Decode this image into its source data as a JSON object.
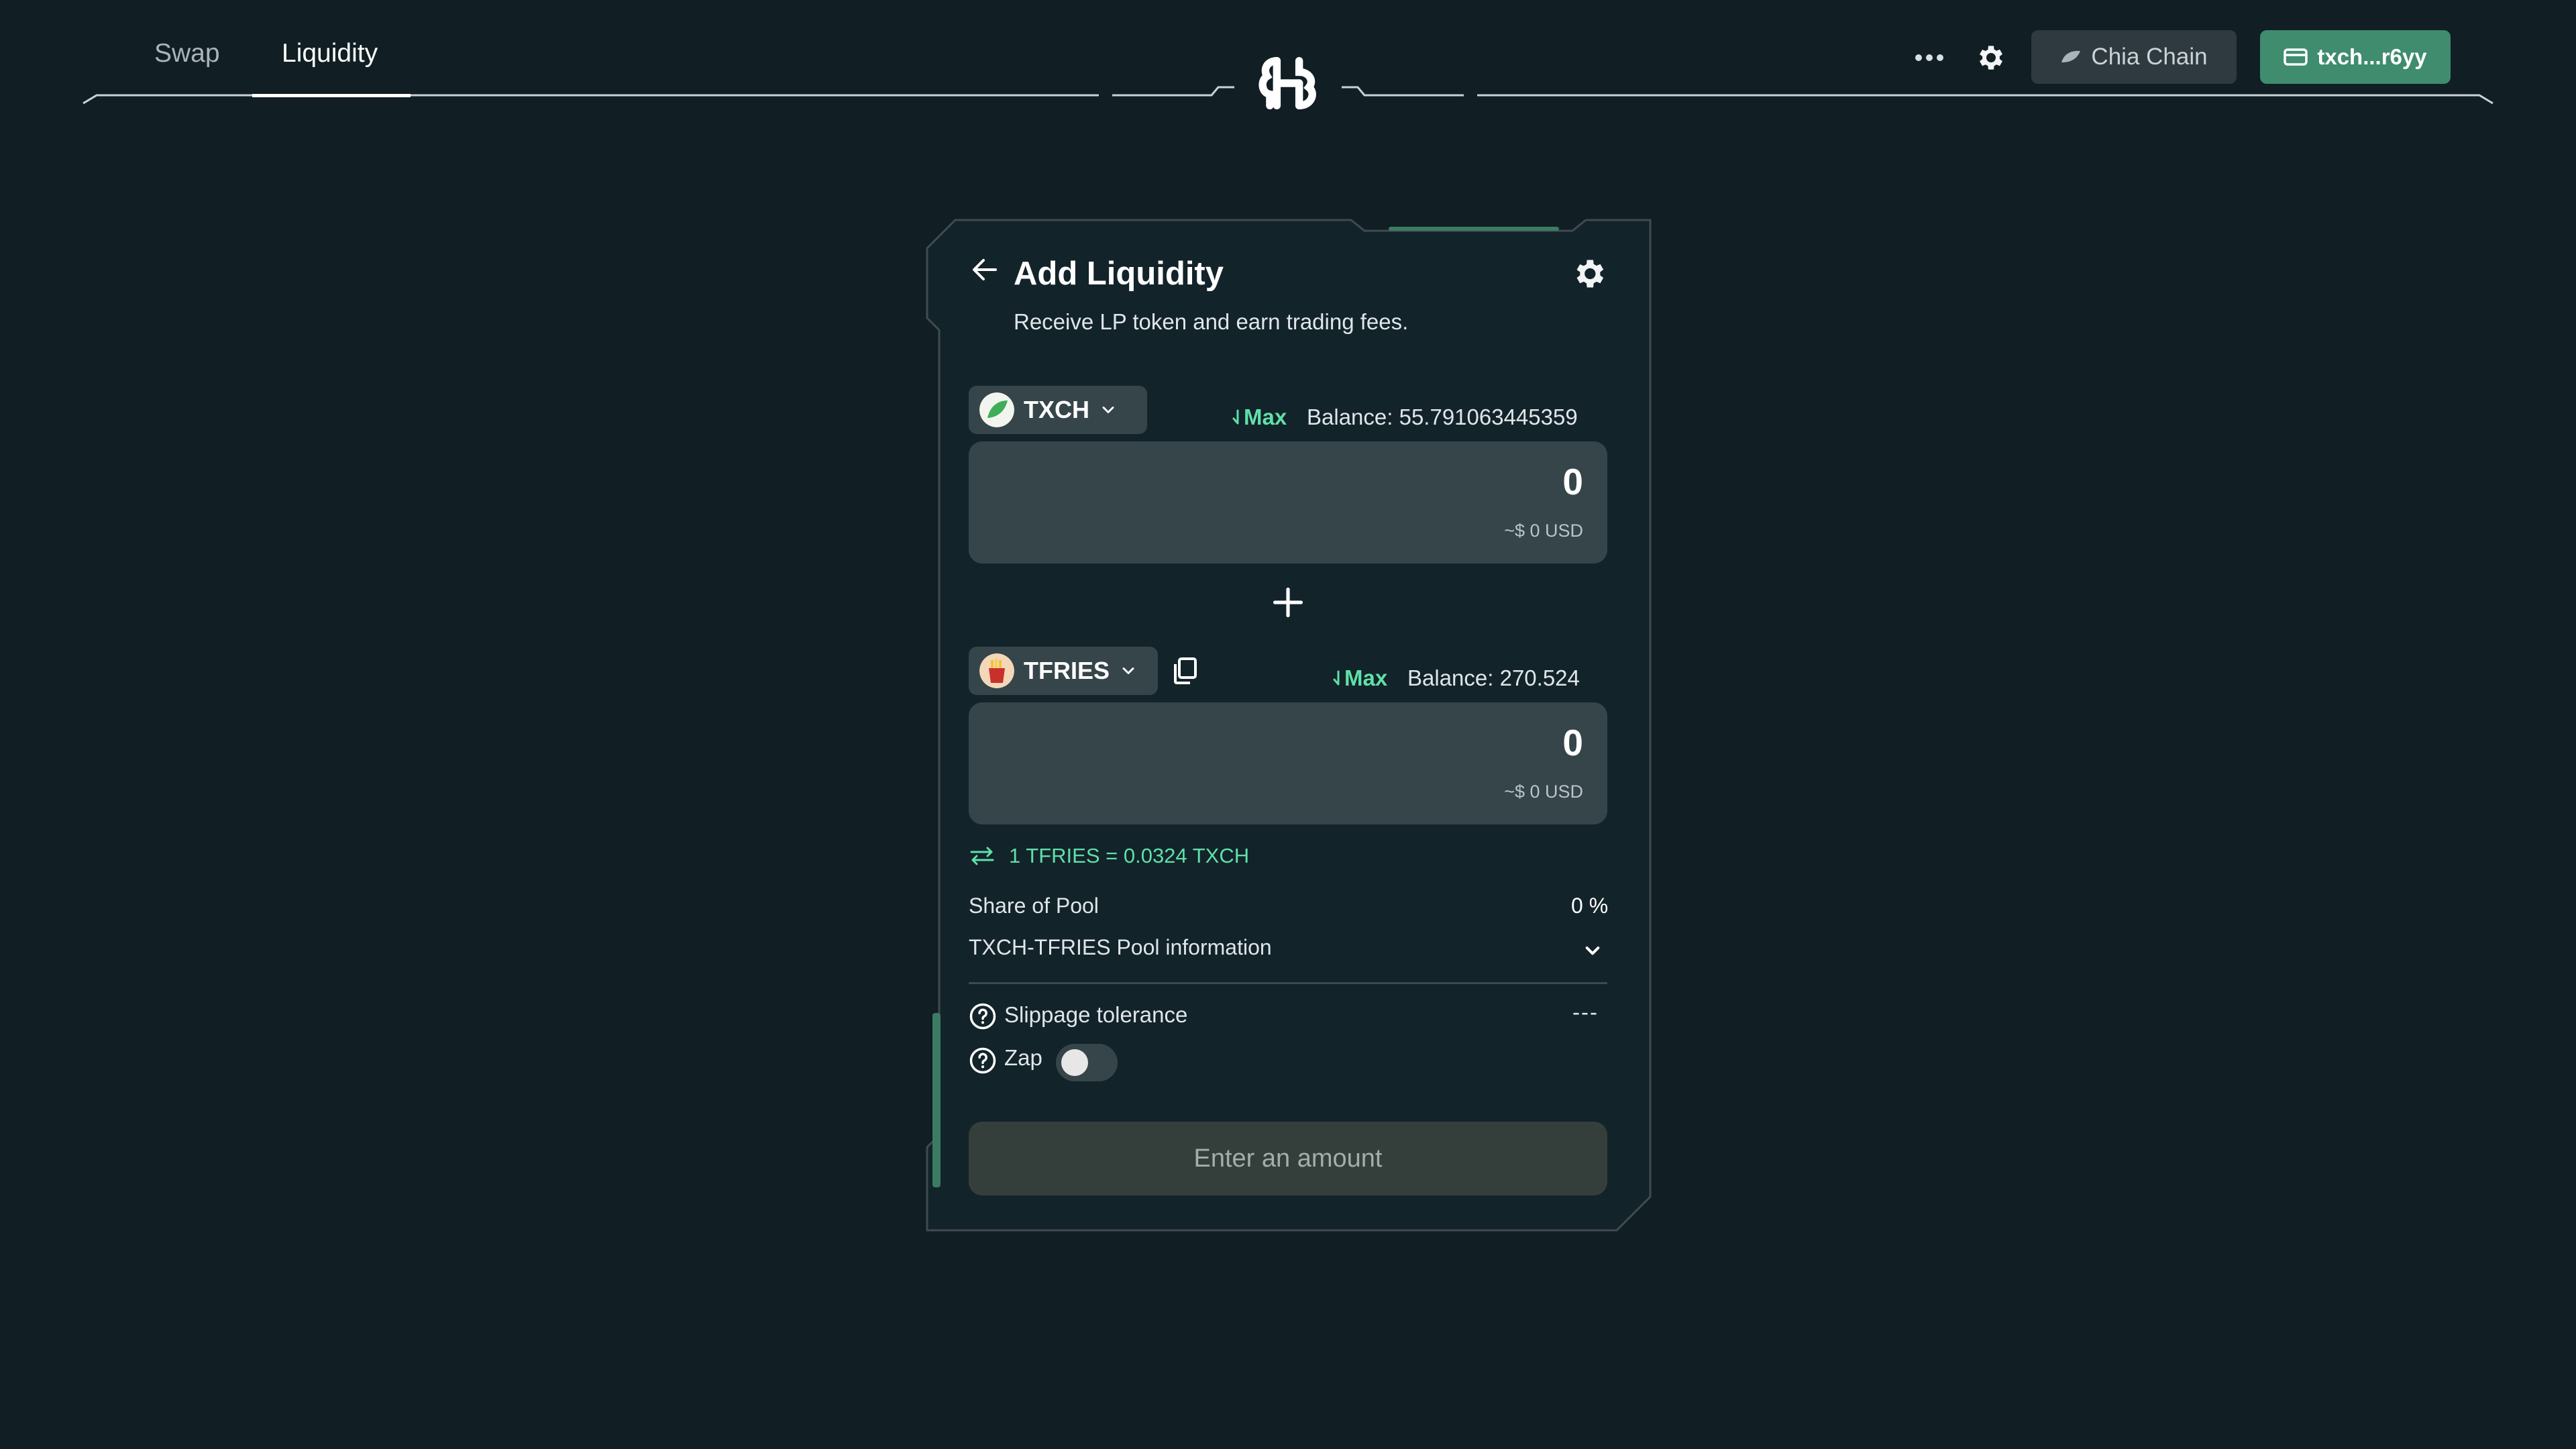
{
  "header": {
    "tabs": [
      {
        "label": "Swap",
        "active": false
      },
      {
        "label": "Liquidity",
        "active": true
      }
    ],
    "more_icon": "more-horizontal-icon",
    "settings_icon": "gear-icon",
    "chain_label": "Chia Chain",
    "wallet_label": "txch...r6yy"
  },
  "card": {
    "title": "Add Liquidity",
    "subtitle": "Receive LP token and earn trading fees.",
    "token_a": {
      "symbol": "TXCH",
      "max_label": "Max",
      "balance": "Balance: 55.791063445359",
      "amount": "0",
      "usd": "~$ 0 USD"
    },
    "token_b": {
      "symbol": "TFRIES",
      "max_label": "Max",
      "balance": "Balance: 270.524",
      "amount": "0",
      "usd": "~$ 0 USD"
    },
    "rate": "1 TFRIES = 0.0324 TXCH",
    "share_label": "Share of Pool",
    "share_value": "0 %",
    "pool_info_label": "TXCH-TFRIES Pool information",
    "slippage_label": "Slippage tolerance",
    "slippage_value": "---",
    "zap_label": "Zap",
    "zap_enabled": false,
    "submit_label": "Enter an amount"
  },
  "colors": {
    "background": "#111e24",
    "accent": "#5fe0a8",
    "wallet_button": "#3f8c6f",
    "panel": "#36454a"
  }
}
